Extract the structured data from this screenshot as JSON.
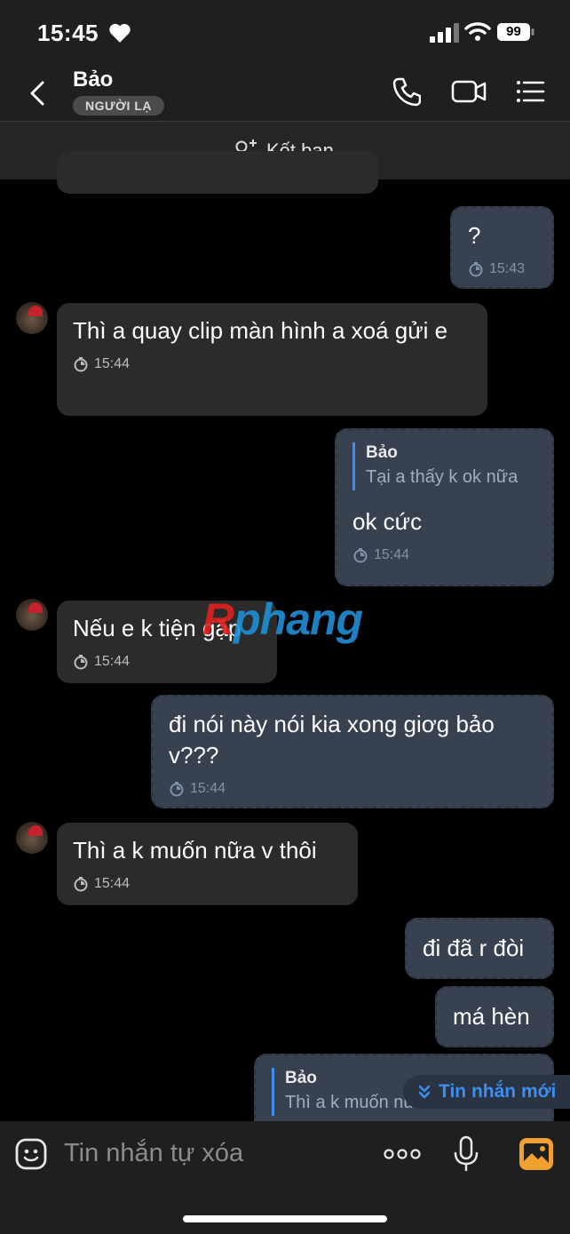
{
  "status": {
    "time": "15:45",
    "battery": "99"
  },
  "header": {
    "name": "Bảo",
    "badge": "NGƯỜI LẠ"
  },
  "friend": {
    "label": "Kết bạn"
  },
  "messages": [
    {
      "text": "?",
      "time": "15:43"
    },
    {
      "text": "Thì a quay clip màn hình a xoá gửi e",
      "time": "15:44"
    },
    {
      "reply_name": "Bảo",
      "reply_text": "Tại a thấy k ok nữa",
      "text": "ok cức",
      "time": "15:44"
    },
    {
      "text": "Nếu e k tiện gặp",
      "time": "15:44"
    },
    {
      "text": "đi nói này nói kia xong giơg bảo v???",
      "time": "15:44"
    },
    {
      "text": "Thì a k muốn nữa v thôi",
      "time": "15:44"
    },
    {
      "text": "đi đã r đòi"
    },
    {
      "text": "má hèn"
    },
    {
      "reply_name": "Bảo",
      "reply_text": "Thì a k muốn nữa v thôi"
    }
  ],
  "new_messages": "Tin nhắn mới",
  "composer": {
    "placeholder": "Tin nhắn tự xóa"
  },
  "watermark": {
    "prefix": "R",
    "rest": "phang"
  },
  "colors": {
    "accent": "#3d8ef0",
    "outgoing": "#38414f",
    "incoming": "#2b2b2b",
    "gallery": "#f0a030"
  }
}
